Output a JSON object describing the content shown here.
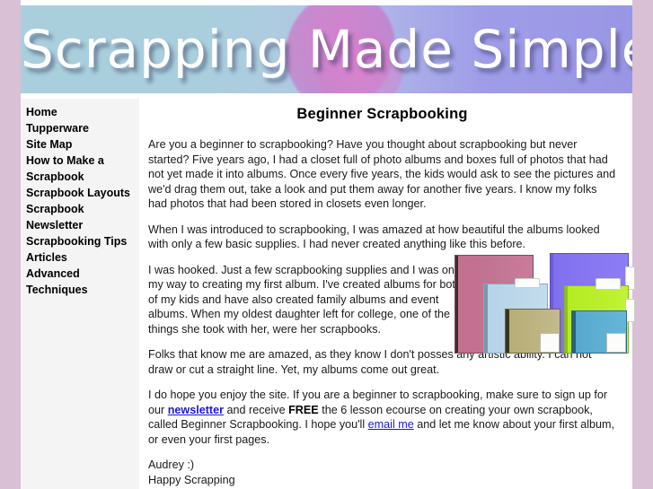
{
  "banner": {
    "title": "Scrapping Made Simple",
    "gradient_left": "#a9cfdd",
    "gradient_right": "#9a96e6",
    "blob_color": "#d878c8",
    "border_color": "#d9c0d5"
  },
  "sidebar": {
    "items": [
      {
        "label": "Home"
      },
      {
        "label": "Tupperware"
      },
      {
        "label": "Site Map"
      },
      {
        "label": "How to Make a Scrapbook"
      },
      {
        "label": "Scrapbook Layouts"
      },
      {
        "label": "Scrapbook Newsletter"
      },
      {
        "label": "Scrapbooking Tips"
      },
      {
        "label": "Articles"
      },
      {
        "label": "Advanced Techniques"
      }
    ]
  },
  "main": {
    "title": "Beginner Scrapbooking",
    "paragraph1": "Are you a beginner to scrapbooking? Have you thought about scrapbooking but never started? Five years ago, I had a closet full of photo albums and boxes full of photos that had not yet made it into albums. Once every five years, the kids would ask to see the pictures and we'd drag them out, take a look and put them away for another five years. I know my folks had photos that had been stored in closets even longer.",
    "paragraph2": "When I was introduced to scrapbooking, I was amazed at how beautiful the albums looked with only a few basic supplies. I had never created anything like this before.",
    "paragraph3": "I was hooked. Just a few scrapbooking supplies and I was on my way to creating my first album. I've created albums for both of my kids and have also created family albums and event albums. When my oldest daughter left for college, one of the things she took with her, were her scrapbooks.",
    "paragraph4": "Folks that know me are amazed, as they know I don't posses any artistic ability. I can not draw or cut a straight line. Yet, my albums come out great.",
    "paragraph5": {
      "part1": "I do hope you enjoy the site. If you are a beginner to scrapbooking, make sure to sign up for our ",
      "link_newsletter": "newsletter",
      "part2": " and receive ",
      "emphasis_free": "FREE",
      "part3": " the 6 lesson ecourse on creating your own scrapbook, called Beginner Scrapbooking. I hope you'll ",
      "link_email": "email me",
      "part4": " and let me know about your first album, or even your first pages."
    },
    "signature_line1": "Audrey :)",
    "signature_line2": "Happy Scrapping",
    "link_color": "#1a1ad0"
  },
  "album_image": {
    "alt": "scrapbook-albums-photo",
    "albums": [
      {
        "name": "pink-album",
        "color": "#c4708f"
      },
      {
        "name": "purple-album",
        "color": "#8070ee"
      },
      {
        "name": "light-blue-album",
        "color": "#b6d3e8"
      },
      {
        "name": "green-album",
        "color": "#b4ec22"
      },
      {
        "name": "tan-album",
        "color": "#b6ad78"
      },
      {
        "name": "teal-album",
        "color": "#57a8cc"
      }
    ]
  }
}
